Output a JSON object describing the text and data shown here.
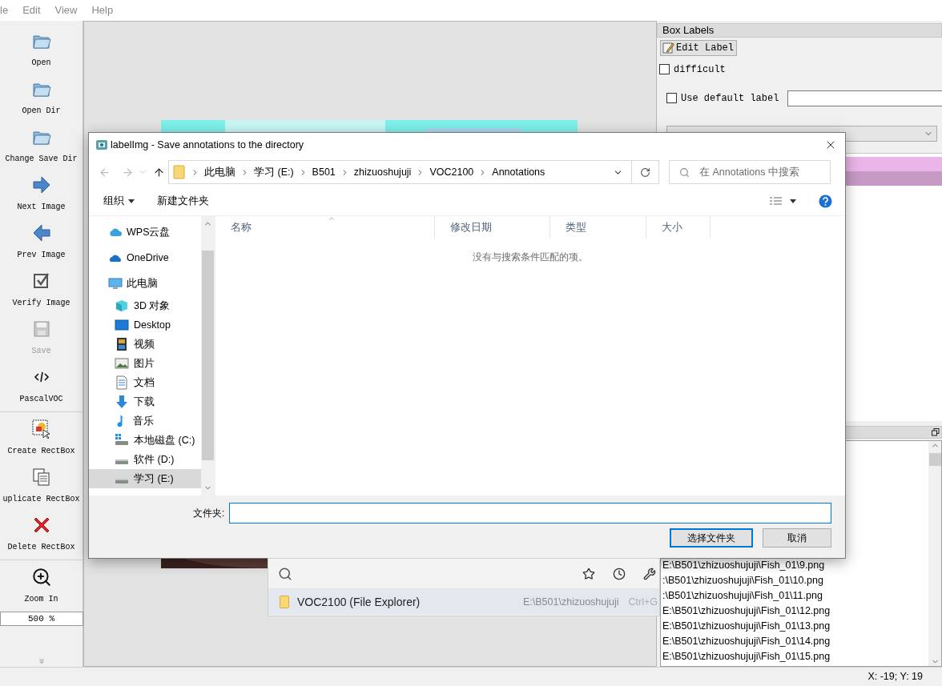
{
  "menu": [
    "le",
    "Edit",
    "View",
    "Help"
  ],
  "toolbar": {
    "groups": [
      {
        "items": [
          {
            "kind": "open",
            "label": "Open",
            "disabled": false
          },
          {
            "kind": "open_dir",
            "label": "Open Dir",
            "disabled": false
          },
          {
            "kind": "change_save_dir",
            "label": "Change Save Dir",
            "disabled": false
          },
          {
            "kind": "next",
            "label": "Next Image",
            "disabled": false
          },
          {
            "kind": "prev",
            "label": "Prev Image",
            "disabled": false
          },
          {
            "kind": "verify",
            "label": "Verify Image",
            "disabled": false
          },
          {
            "kind": "save",
            "label": "Save",
            "disabled": true
          },
          {
            "kind": "format",
            "label": "PascalVOC",
            "disabled": false
          }
        ]
      },
      {
        "items": [
          {
            "kind": "create",
            "label": "Create RectBox",
            "disabled": false
          },
          {
            "kind": "duplicate",
            "label": "uplicate RectBox",
            "disabled": false
          },
          {
            "kind": "delete",
            "label": "Delete RectBox",
            "disabled": false
          }
        ]
      },
      {
        "items": [
          {
            "kind": "zoom_in",
            "label": "Zoom In",
            "disabled": false
          },
          {
            "kind": "zoom_field",
            "value": "500 %"
          }
        ]
      }
    ]
  },
  "box_labels": {
    "title": "Box Labels",
    "edit_button": "Edit Label",
    "difficult": {
      "label": "difficult",
      "checked": false
    },
    "default_label": {
      "label": "Use default label",
      "checked": false
    },
    "label_rows": [
      {
        "color": "#ebb5e7"
      },
      {
        "color": "#c799c5"
      }
    ]
  },
  "file_list": [
    "E:\\B501\\zhizuoshujuji\\Fish_01\\9.png",
    ":\\B501\\zhizuoshujuji\\Fish_01\\10.png",
    ":\\B501\\zhizuoshujuji\\Fish_01\\11.png",
    "E:\\B501\\zhizuoshujuji\\Fish_01\\12.png",
    "E:\\B501\\zhizuoshujuji\\Fish_01\\13.png",
    "E:\\B501\\zhizuoshujuji\\Fish_01\\14.png",
    "E:\\B501\\zhizuoshujuji\\Fish_01\\15.png"
  ],
  "status_bar": {
    "coords": "X: -19; Y: 19"
  },
  "dialog": {
    "title": "labelImg - Save annotations to the directory",
    "path": [
      "此电脑",
      "学习 (E:)",
      "B501",
      "zhizuoshujuji",
      "VOC2100",
      "Annotations"
    ],
    "search": {
      "placeholder": "在 Annotations 中搜索"
    },
    "commands": [
      "组织",
      "新建文件夹"
    ],
    "nav": [
      {
        "kind": "wps",
        "label": "WPS云盘",
        "selected": false
      },
      {
        "kind": "onedrive",
        "label": "OneDrive",
        "selected": false
      },
      {
        "kind": "computer",
        "label": "此电脑",
        "selected": false,
        "children": [
          {
            "kind": "objects3d",
            "label": "3D 对象",
            "selected": false
          },
          {
            "kind": "desktop",
            "label": "Desktop",
            "selected": false
          },
          {
            "kind": "video",
            "label": "视频",
            "selected": false
          },
          {
            "kind": "pictures",
            "label": "图片",
            "selected": false
          },
          {
            "kind": "documents",
            "label": "文档",
            "selected": false
          },
          {
            "kind": "downloads",
            "label": "下载",
            "selected": false
          },
          {
            "kind": "music",
            "label": "音乐",
            "selected": false
          },
          {
            "kind": "system_drive",
            "label": "本地磁盘 (C:)",
            "selected": false
          },
          {
            "kind": "drive",
            "label": "软件 (D:)",
            "selected": false
          },
          {
            "kind": "drive",
            "label": "学习 (E:)",
            "selected": true
          }
        ]
      }
    ],
    "columns": [
      "名称",
      "修改日期",
      "类型",
      "大小"
    ],
    "empty_message": "没有与搜索条件匹配的项。",
    "folder_label": "文件夹:",
    "buttons": [
      {
        "label": "选择文件夹",
        "default": true
      },
      {
        "label": "取消",
        "default": false
      }
    ]
  },
  "quick_search": {
    "result": {
      "title": "VOC2100 (File Explorer)",
      "path": "E:\\B501\\zhizuoshujuji",
      "shortcut": "Ctrl+G"
    }
  }
}
